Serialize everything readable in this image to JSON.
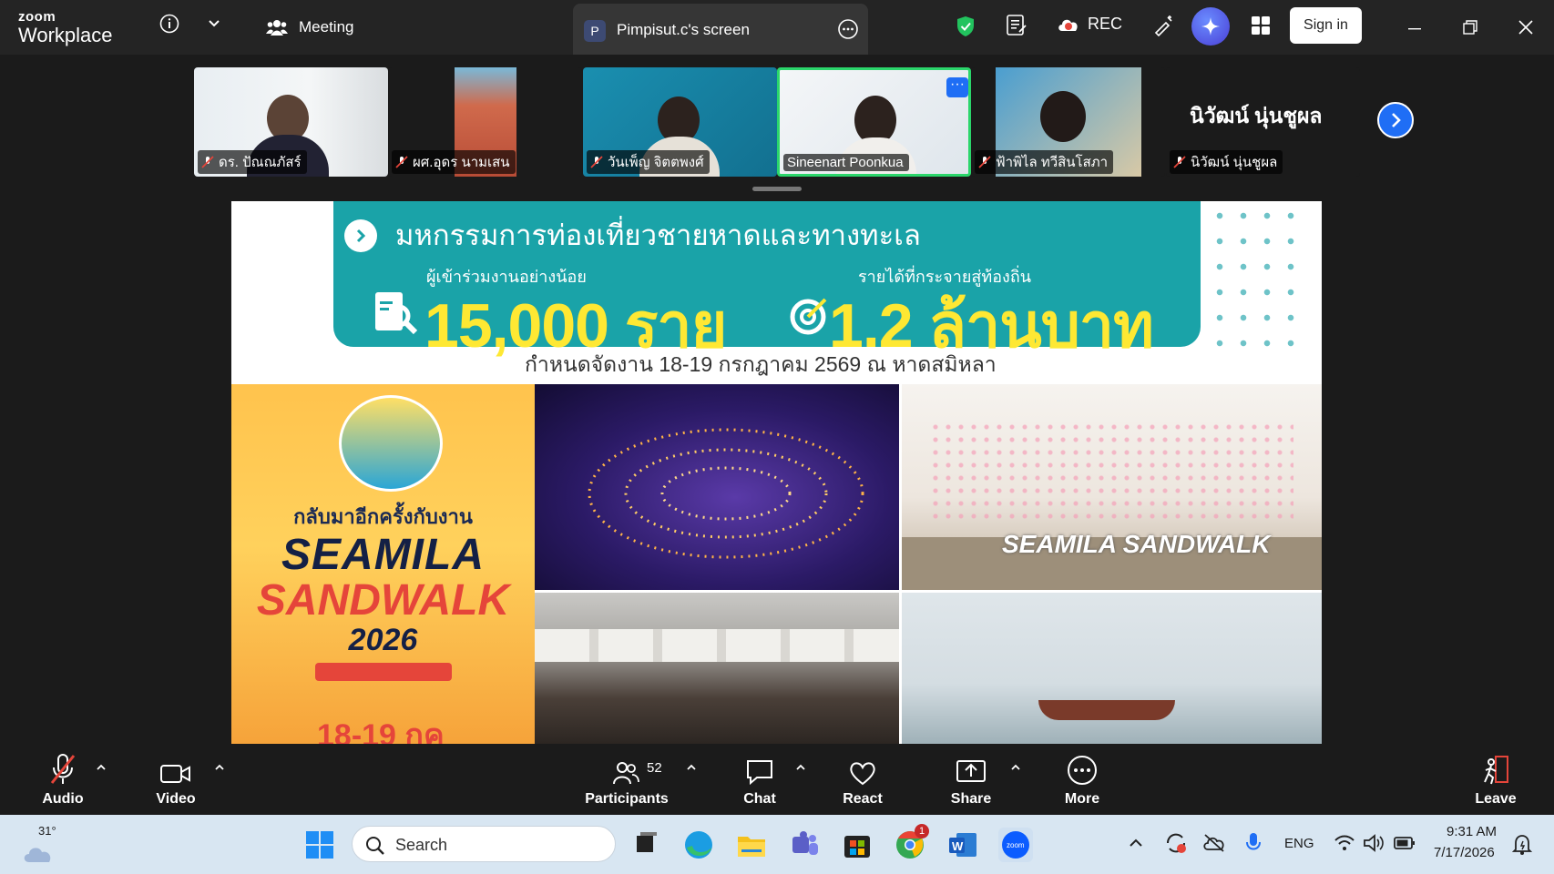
{
  "titlebar": {
    "brand_line1": "zoom",
    "brand_line2": "Workplace",
    "meeting_label": "Meeting",
    "screen_tab_badge": "P",
    "screen_tab_label": "Pimpisut.c's screen",
    "rec_label": "REC",
    "signin_label": "Sign in"
  },
  "gallery": {
    "participants": [
      {
        "name": "ดร. ปัณณภัสร์",
        "muted": true
      },
      {
        "name": "ผศ.อุดร นามเสน",
        "muted": true
      },
      {
        "name": "วันเพ็ญ จิตตพงศ์",
        "muted": true
      },
      {
        "name": "Sineenart Poonkua",
        "muted": false,
        "active": true
      },
      {
        "name": "ฟ้าพิไล ทวีสินโสภา",
        "muted": true
      },
      {
        "name": "นิวัฒน์ นุ่นชูผล",
        "muted": true
      }
    ],
    "large_name": "นิวัฒน์ นุ่นชูผล"
  },
  "slide": {
    "title": "มหกรรมการท่องเที่ยวชายหาดและทางทะเล",
    "stat1_caption": "ผู้เข้าร่วมงานอย่างน้อย",
    "stat1_value": "15,000 ราย",
    "stat2_caption": "รายได้ที่กระจายสู่ท้องถิ่น",
    "stat2_value": "1.2 ล้านบาท",
    "dateline": "กำหนดจัดงาน 18-19 กรกฎาคม 2569 ณ หาดสมิหลา",
    "poster": {
      "line1": "กลับมาอีกครั้งกับงาน",
      "word1": "SEAMILA",
      "word2": "SANDWALK",
      "year": "2026",
      "date": "18-19 กค"
    },
    "stage_text": "SEAMILA SANDWALK"
  },
  "toolbar": {
    "audio": "Audio",
    "video": "Video",
    "participants": "Participants",
    "participants_count": "52",
    "chat": "Chat",
    "react": "React",
    "share": "Share",
    "more": "More",
    "leave": "Leave"
  },
  "taskbar": {
    "weather_temp": "31°",
    "search_label": "Search",
    "lang": "ENG",
    "time": "9:31 AM",
    "date": "7/17/2026",
    "chrome_badge": "1"
  },
  "colors": {
    "accent_blue": "#1f6ef5",
    "banner_teal": "#1aa3a8",
    "banner_yellow": "#fee833",
    "active_border": "#2bd66b",
    "mute_red": "#e5453a"
  }
}
